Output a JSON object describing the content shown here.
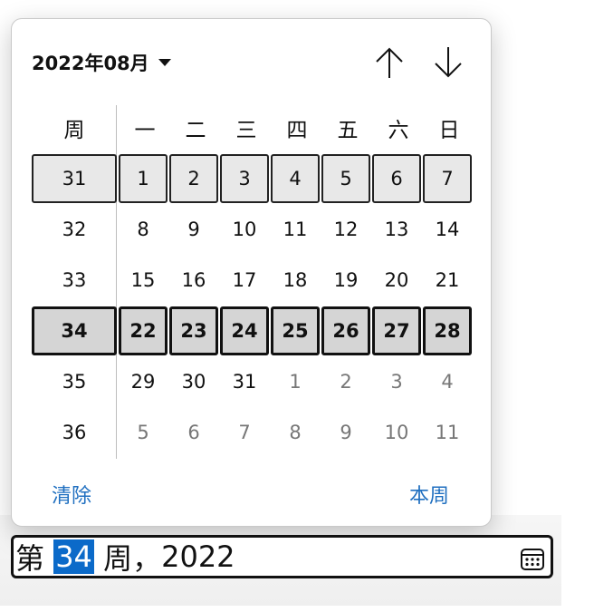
{
  "picker": {
    "month_label": "2022年08月",
    "header": {
      "week_col": "周",
      "weekdays": [
        "一",
        "二",
        "三",
        "四",
        "五",
        "六",
        "日"
      ]
    },
    "rows": [
      {
        "week": "31",
        "days": [
          {
            "d": "1"
          },
          {
            "d": "2"
          },
          {
            "d": "3"
          },
          {
            "d": "4"
          },
          {
            "d": "5"
          },
          {
            "d": "6"
          },
          {
            "d": "7"
          }
        ],
        "state": "hover"
      },
      {
        "week": "32",
        "days": [
          {
            "d": "8"
          },
          {
            "d": "9"
          },
          {
            "d": "10"
          },
          {
            "d": "11"
          },
          {
            "d": "12"
          },
          {
            "d": "13"
          },
          {
            "d": "14"
          }
        ],
        "state": ""
      },
      {
        "week": "33",
        "days": [
          {
            "d": "15"
          },
          {
            "d": "16"
          },
          {
            "d": "17"
          },
          {
            "d": "18"
          },
          {
            "d": "19"
          },
          {
            "d": "20"
          },
          {
            "d": "21"
          }
        ],
        "state": ""
      },
      {
        "week": "34",
        "days": [
          {
            "d": "22"
          },
          {
            "d": "23"
          },
          {
            "d": "24"
          },
          {
            "d": "25"
          },
          {
            "d": "26"
          },
          {
            "d": "27"
          },
          {
            "d": "28"
          }
        ],
        "state": "selected"
      },
      {
        "week": "35",
        "days": [
          {
            "d": "29"
          },
          {
            "d": "30"
          },
          {
            "d": "31"
          },
          {
            "d": "1",
            "other": true
          },
          {
            "d": "2",
            "other": true
          },
          {
            "d": "3",
            "other": true
          },
          {
            "d": "4",
            "other": true
          }
        ],
        "state": ""
      },
      {
        "week": "36",
        "days": [
          {
            "d": "5",
            "other": true
          },
          {
            "d": "6",
            "other": true
          },
          {
            "d": "7",
            "other": true
          },
          {
            "d": "8",
            "other": true
          },
          {
            "d": "9",
            "other": true
          },
          {
            "d": "10",
            "other": true
          },
          {
            "d": "11",
            "other": true
          }
        ],
        "state": ""
      }
    ],
    "clear_label": "清除",
    "this_week_label": "本周",
    "nav_up_icon": "arrow-up-icon",
    "nav_down_icon": "arrow-down-icon"
  },
  "field": {
    "prefix": "第 ",
    "week": "34",
    "suffix": " 周，",
    "year": "2022",
    "calendar_icon": "calendar-icon"
  },
  "colors": {
    "accent": "#0b6ac9",
    "link": "#1f6fc0",
    "selected_bg": "#d5d5d5",
    "hover_bg": "#e8e8e8"
  }
}
